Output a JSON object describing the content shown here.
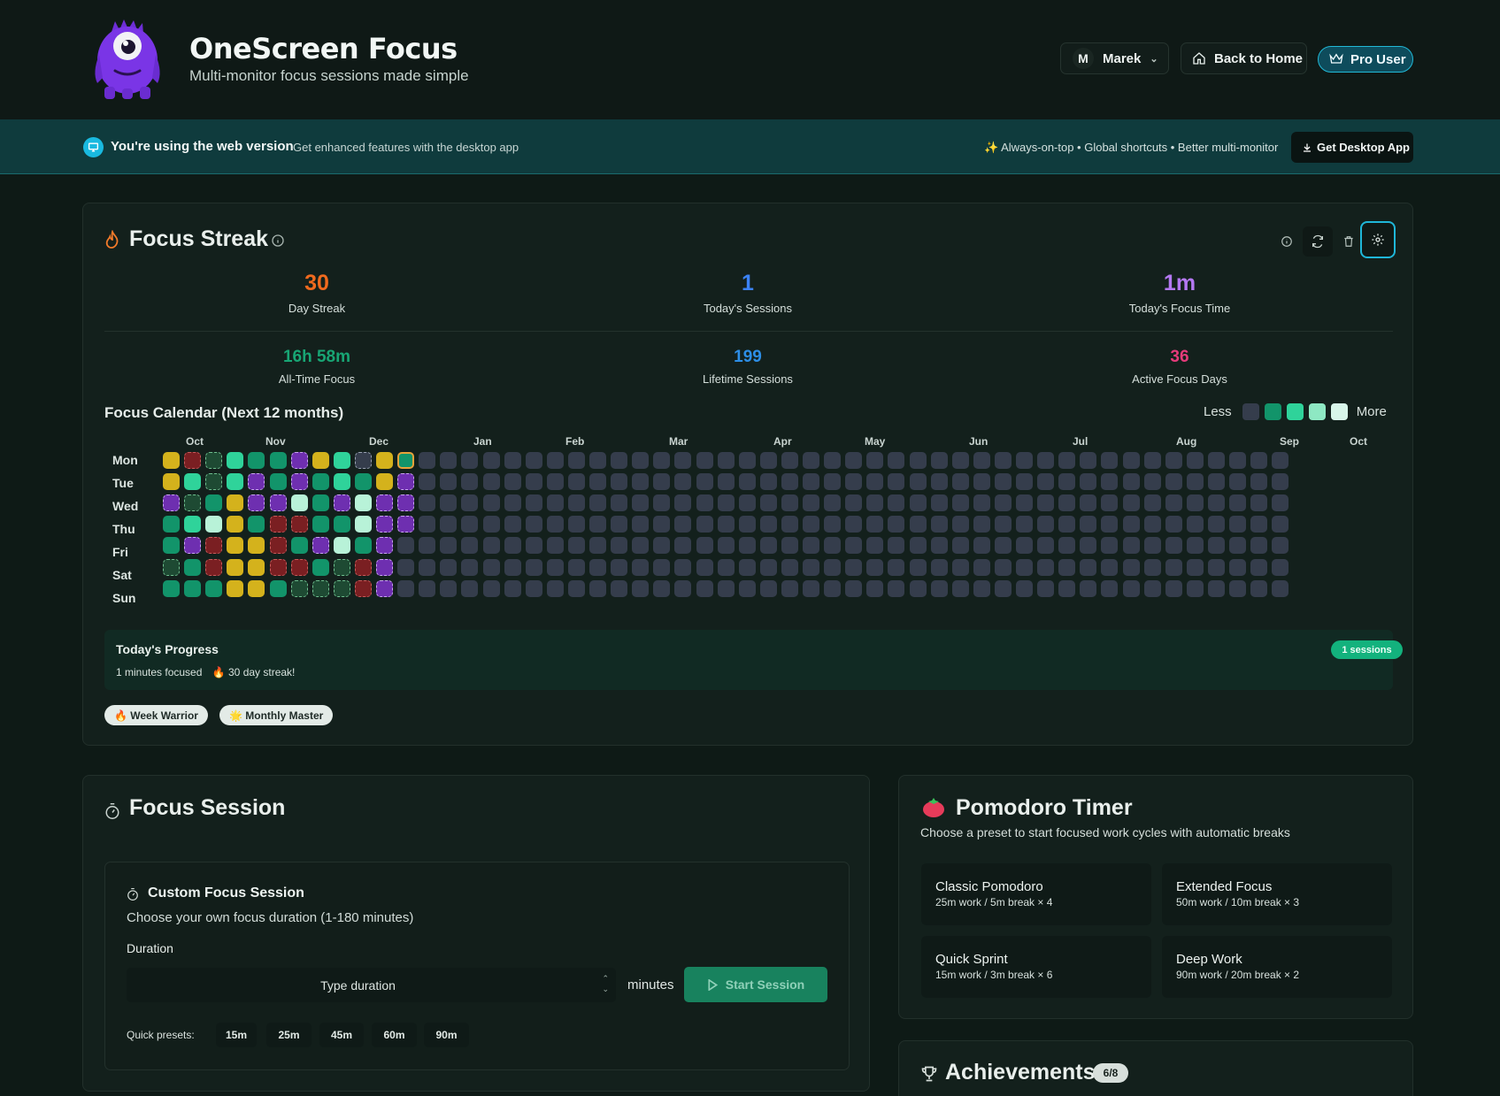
{
  "header": {
    "app_title": "OneScreen Focus",
    "app_subtitle": "Multi-monitor focus sessions made simple",
    "user_initial": "M",
    "user_name": "Marek",
    "home_label": "Back to Home",
    "pro_label": "Pro User"
  },
  "banner": {
    "title": "You're using the web version",
    "subtitle": "Get enhanced features with the desktop app",
    "features": "✨ Always-on-top • Global shortcuts • Better multi-monitor",
    "button": "Get Desktop App"
  },
  "streak": {
    "title": "Focus Streak",
    "stats": [
      {
        "value": "30",
        "label": "Day Streak",
        "color": "#f06a1e"
      },
      {
        "value": "1",
        "label": "Today's Sessions",
        "color": "#3b82f6"
      },
      {
        "value": "1m",
        "label": "Today's Focus Time",
        "color": "#b478f2"
      },
      {
        "value": "16h 58m",
        "label": "All-Time Focus",
        "color": "#18a574"
      },
      {
        "value": "199",
        "label": "Lifetime Sessions",
        "color": "#2d8ee6"
      },
      {
        "value": "36",
        "label": "Active Focus Days",
        "color": "#e53b7a"
      }
    ],
    "calendar_title": "Focus Calendar (Next 12 months)",
    "legend_less": "Less",
    "legend_more": "More",
    "legend_colors": [
      "#353d4c",
      "#12946a",
      "#2fd39a",
      "#8ee8c3",
      "#d8f6ea"
    ],
    "months": [
      "Oct",
      "Nov",
      "Dec",
      "Jan",
      "Feb",
      "Mar",
      "Apr",
      "May",
      "Jun",
      "Jul",
      "Aug",
      "Sep",
      "Oct"
    ],
    "weekdays": [
      "Mon",
      "Tue",
      "Wed",
      "Thu",
      "Fri",
      "Sat",
      "Sun"
    ],
    "progress_title": "Today's Progress",
    "progress_minutes": "1 minutes focused",
    "progress_streak": "🔥 30 day streak!",
    "progress_badge": "1 sessions",
    "badges": [
      "🔥 Week Warrior",
      "🌟 Monthly Master"
    ]
  },
  "session": {
    "title": "Focus Session",
    "custom_title": "Custom Focus Session",
    "custom_desc": "Choose your own focus duration (1-180 minutes)",
    "duration_label": "Duration",
    "duration_placeholder": "Type duration",
    "minutes_label": "minutes",
    "start_label": "Start Session",
    "presets_label": "Quick presets:",
    "presets": [
      "15m",
      "25m",
      "45m",
      "60m",
      "90m"
    ]
  },
  "pomodoro": {
    "title": "Pomodoro Timer",
    "desc": "Choose a preset to start focused work cycles with automatic breaks",
    "presets": [
      {
        "name": "Classic Pomodoro",
        "detail": "25m work / 5m break × 4"
      },
      {
        "name": "Extended Focus",
        "detail": "50m work / 10m break × 3"
      },
      {
        "name": "Quick Sprint",
        "detail": "15m work / 3m break × 6"
      },
      {
        "name": "Deep Work",
        "detail": "90m work / 20m break × 2"
      }
    ]
  },
  "achievements": {
    "title": "Achievements",
    "count": "6/8"
  }
}
